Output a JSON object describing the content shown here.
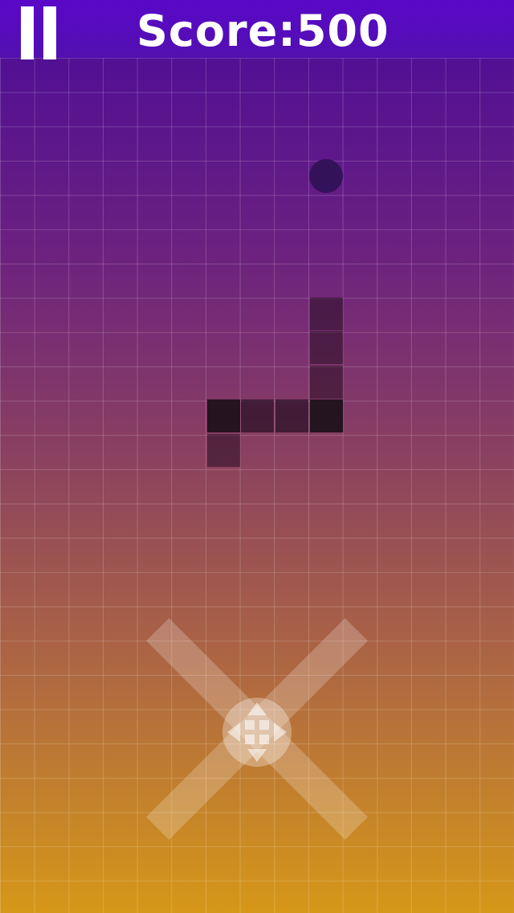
{
  "header": {
    "score_text": "Score:500",
    "pause_icon": "pause-icon"
  },
  "board": {
    "grid_columns": 15,
    "food_icon": "food-dot",
    "snake_segments": [
      "head",
      "body",
      "body",
      "body",
      "body",
      "body",
      "body",
      "body"
    ]
  },
  "controls": {
    "dpad_icon": "move-arrows-icon"
  },
  "colors": {
    "topbar": "#5a08c8",
    "gradient_top": "#4a0a9a",
    "gradient_bottom": "#d69818",
    "snake_head": "#23141f",
    "food": "#34125a"
  }
}
